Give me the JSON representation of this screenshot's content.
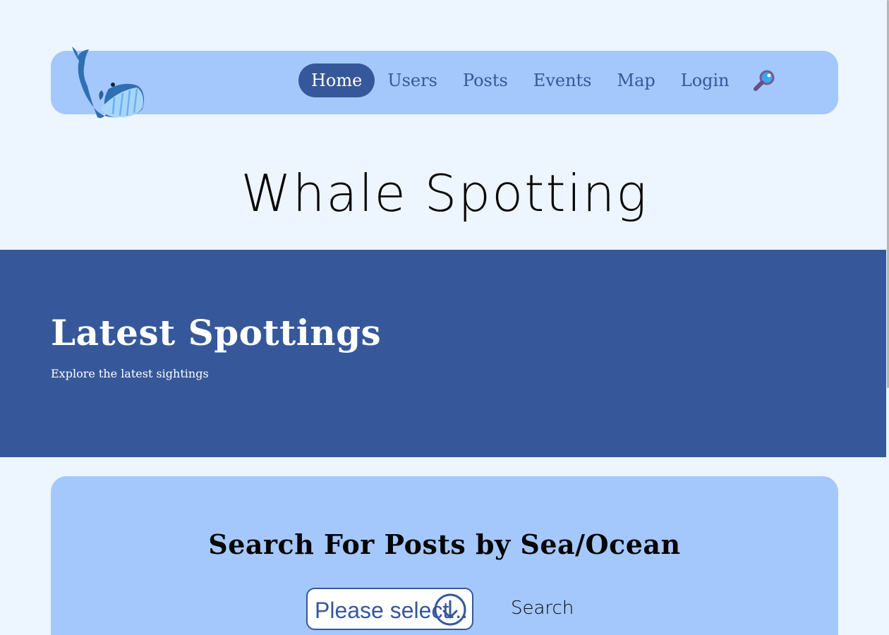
{
  "nav": {
    "links": [
      "Home",
      "Users",
      "Posts",
      "Events",
      "Map",
      "Login"
    ],
    "active": "Home",
    "search_icon": "magnifier-icon",
    "logo_icon": "whale-logo"
  },
  "site_title": "Whale Spotting",
  "hero": {
    "title": "Latest Spottings",
    "subtitle": "Explore the latest sightings"
  },
  "search": {
    "heading": "Search For Posts by Sea/Ocean",
    "select_value": "Please select...",
    "button_label": "Search"
  },
  "colors": {
    "page_bg": "#edf5ff",
    "panel": "#a4c8fc",
    "accent": "#36579a",
    "hero_bg": "#36589a"
  }
}
